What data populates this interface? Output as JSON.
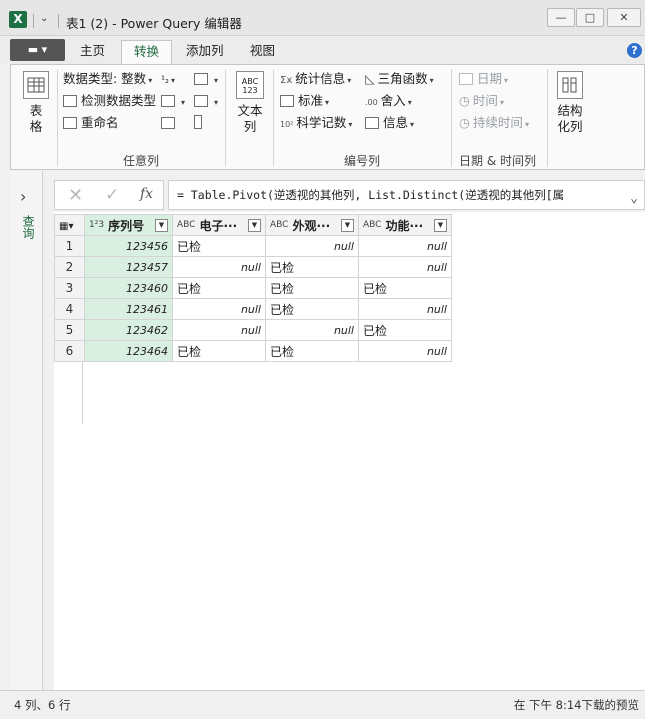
{
  "window": {
    "title": "表1 (2) - Power Query 编辑器",
    "app_icon": "X",
    "quick_access": "⌄",
    "minimize": "—",
    "maximize": "□",
    "close": "✕"
  },
  "tabs": {
    "file": "▬ ▾",
    "items": [
      "主页",
      "转换",
      "添加列",
      "视图"
    ],
    "active": "转换",
    "help": "?"
  },
  "ribbon": {
    "table_btn": "表格",
    "data_type": "数据类型: 整数",
    "detect_type": "检测数据类型",
    "rename": "重命名",
    "any_column_group": "任意列",
    "text_column_btn": "文本列",
    "statistics": "统计信息",
    "standard": "标准",
    "scientific": "科学记数",
    "trig": "三角函数",
    "rounding": "舍入",
    "information": "信息",
    "number_column_group": "编号列",
    "date": "日期",
    "time": "时间",
    "duration": "持续时间",
    "datetime_group": "日期 & 时间列",
    "structured_btn": "结构化列",
    "text_icon_label": "ABC 123"
  },
  "left_pane": {
    "expander": "›",
    "label": "查询"
  },
  "formula_bar": {
    "cancel": "✕",
    "accept": "✓",
    "fx": "fx",
    "formula": "= Table.Pivot(逆透视的其他列, List.Distinct(逆透视的其他列[属",
    "expand": "⌄"
  },
  "grid": {
    "columns": [
      {
        "type": "1²3",
        "name": "序列号"
      },
      {
        "type": "ABC",
        "name": "电子···"
      },
      {
        "type": "ABC",
        "name": "外观···"
      },
      {
        "type": "ABC",
        "name": "功能···"
      }
    ],
    "rows": [
      [
        "1",
        "123456",
        "已检",
        "null",
        "null"
      ],
      [
        "2",
        "123457",
        "null",
        "已检",
        "null"
      ],
      [
        "3",
        "123460",
        "已检",
        "已检",
        "已检"
      ],
      [
        "4",
        "123461",
        "null",
        "已检",
        "null"
      ],
      [
        "5",
        "123462",
        "null",
        "null",
        "已检"
      ],
      [
        "6",
        "123464",
        "已检",
        "已检",
        "null"
      ]
    ]
  },
  "status": {
    "left": "4 列、6 行",
    "right": "在 下午 8:14下载的预览"
  },
  "colors": {
    "accent_green": "#1d6b3e",
    "key_column_bg": "#d9efe1"
  }
}
